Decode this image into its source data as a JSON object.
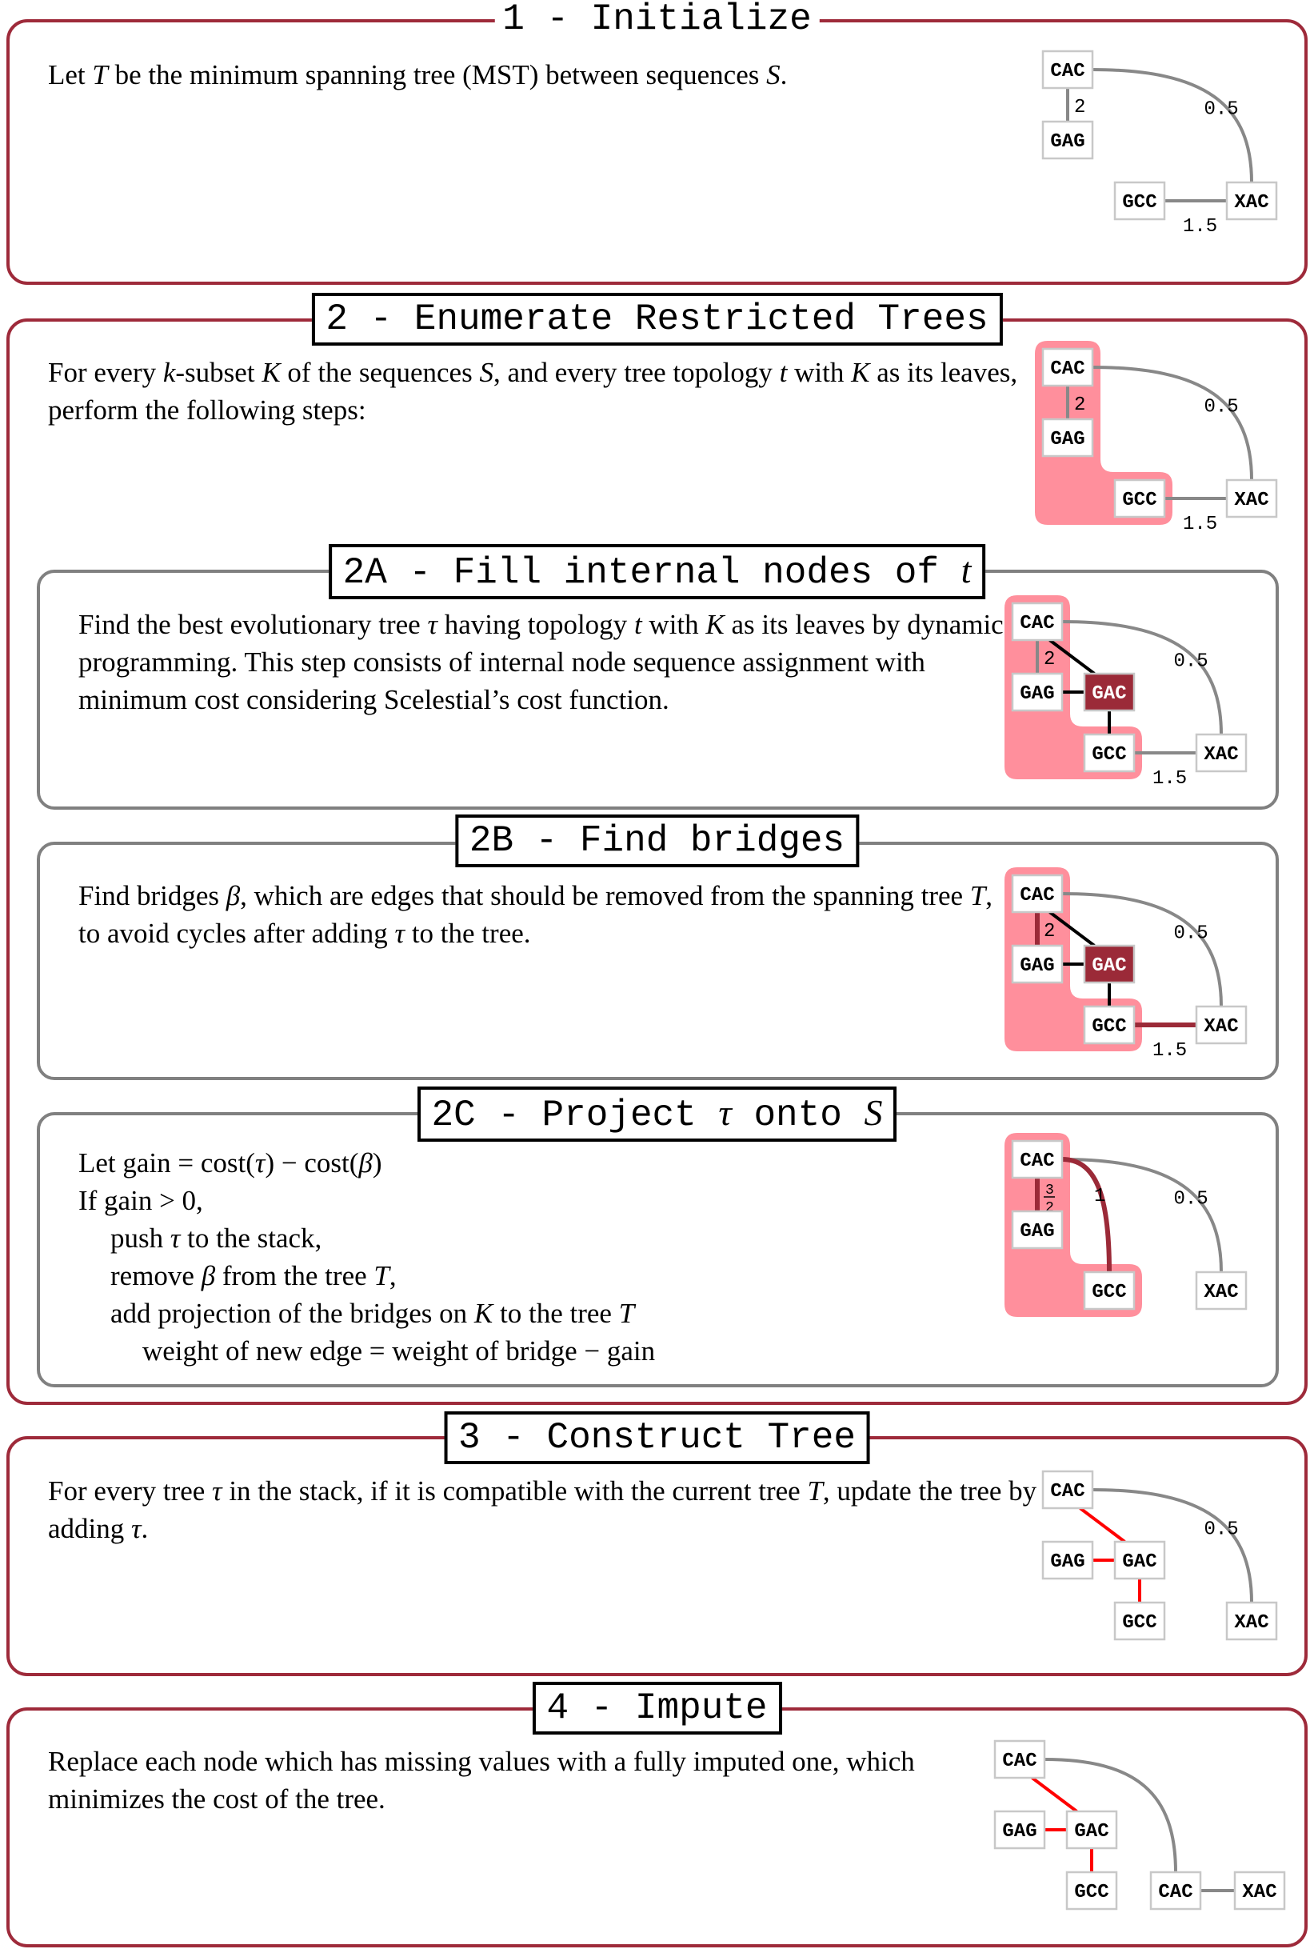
{
  "colors": {
    "outer_frame": "#9e2a3a",
    "inner_frame": "#808080",
    "highlight_fill": "#ff8f9c",
    "internal_node_fill": "#9b2a38",
    "node_border": "#c8c8c8",
    "mst_edge": "#888888",
    "tau_edge": "#000000",
    "bridge_edge": "#9b2a38",
    "added_edge": "#ff0000"
  },
  "sections": {
    "s1": {
      "title": "1 - Initialize",
      "text": [
        "Let ",
        {
          "math": "T"
        },
        " be the minimum spanning tree (MST) between sequences ",
        {
          "math": "S"
        },
        "."
      ]
    },
    "s2": {
      "title": "2 - Enumerate Restricted Trees",
      "text": [
        "For every ",
        {
          "math": "k"
        },
        "-subset ",
        {
          "math": "K"
        },
        " of the sequences ",
        {
          "math": "S"
        },
        ", and every tree topology ",
        {
          "math": "t"
        },
        " with ",
        {
          "math": "K"
        },
        " as its leaves, perform the following steps:"
      ]
    },
    "s2a": {
      "title_prefix": "2A - Fill internal nodes of ",
      "title_math": "t",
      "text": [
        "Find the best evolutionary tree ",
        {
          "math": "τ"
        },
        " having topology ",
        {
          "math": "t"
        },
        " with ",
        {
          "math": "K"
        },
        " as its leaves by dynamic programming.  This step consists of internal node sequence assignment with minimum cost considering Scelestial’s cost function."
      ]
    },
    "s2b": {
      "title": "2B - Find bridges",
      "text": [
        "Find bridges ",
        {
          "math": "β"
        },
        ", which are edges that should be removed from the spanning tree ",
        {
          "math": "T"
        },
        ", to avoid cycles after adding ",
        {
          "math": "τ"
        },
        " to the tree."
      ]
    },
    "s2c": {
      "title_prefix": "2C - Project ",
      "title_math1": "τ",
      "title_mid": " onto ",
      "title_math2": "S",
      "lines": [
        {
          "indent": 0,
          "parts": [
            "Let gain = cost(",
            {
              "math": "τ"
            },
            ") − cost(",
            {
              "math": "β"
            },
            ")"
          ]
        },
        {
          "indent": 0,
          "parts": [
            "If gain > 0,"
          ]
        },
        {
          "indent": 1,
          "parts": [
            "push ",
            {
              "math": "τ"
            },
            " to the stack,"
          ]
        },
        {
          "indent": 1,
          "parts": [
            "remove ",
            {
              "math": "β"
            },
            " from the tree ",
            {
              "math": "T"
            },
            ","
          ]
        },
        {
          "indent": 1,
          "parts": [
            "add projection of the bridges on ",
            {
              "math": "K"
            },
            " to the tree ",
            {
              "math": "T"
            }
          ]
        },
        {
          "indent": 2,
          "parts": [
            "weight of new edge = weight of bridge − gain"
          ]
        }
      ]
    },
    "s3": {
      "title": "3 - Construct Tree",
      "text": [
        "For every tree ",
        {
          "math": "τ"
        },
        " in the stack, if it is compatible with the current tree ",
        {
          "math": "T"
        },
        ", update the tree by adding ",
        {
          "math": "τ"
        },
        "."
      ]
    },
    "s4": {
      "title": "4 - Impute",
      "text": [
        "Replace each node which has missing values with a fully imputed one, which minimizes the cost of the tree."
      ]
    }
  },
  "diagrams": {
    "d1": {
      "nodes": [
        {
          "id": "CAC1",
          "label": "CAC",
          "col": 0,
          "row": 0
        },
        {
          "id": "GAG",
          "label": "GAG",
          "col": 0,
          "row": 1
        },
        {
          "id": "GCC",
          "label": "GCC",
          "col": 1,
          "row": 2
        },
        {
          "id": "XAC",
          "label": "XAC",
          "col": 2,
          "row": 2
        }
      ],
      "edges": [
        {
          "from": "CAC1",
          "to": "GAG",
          "label": "2",
          "style": "mst"
        },
        {
          "from": "CAC1",
          "to": "XAC",
          "label": "0.5",
          "style": "mst",
          "curve": true
        },
        {
          "from": "GCC",
          "to": "XAC",
          "label": "1.5",
          "style": "mst"
        }
      ]
    },
    "d2": {
      "highlight": [
        "CAC1",
        "GAG",
        "GCC"
      ],
      "nodes": [
        {
          "id": "CAC1",
          "label": "CAC",
          "col": 0,
          "row": 0
        },
        {
          "id": "GAG",
          "label": "GAG",
          "col": 0,
          "row": 1
        },
        {
          "id": "GCC",
          "label": "GCC",
          "col": 1,
          "row": 2
        },
        {
          "id": "XAC",
          "label": "XAC",
          "col": 2,
          "row": 2
        }
      ],
      "edges": [
        {
          "from": "CAC1",
          "to": "GAG",
          "label": "2",
          "style": "mst"
        },
        {
          "from": "CAC1",
          "to": "XAC",
          "label": "0.5",
          "style": "mst",
          "curve": true
        },
        {
          "from": "GCC",
          "to": "XAC",
          "label": "1.5",
          "style": "mst"
        }
      ]
    },
    "d2a": {
      "highlight": [
        "CAC1",
        "GAG",
        "GCC"
      ],
      "nodes": [
        {
          "id": "CAC1",
          "label": "CAC",
          "col": 0,
          "row": 0
        },
        {
          "id": "GAG",
          "label": "GAG",
          "col": 0,
          "row": 1
        },
        {
          "id": "GAC",
          "label": "GAC",
          "col": 1,
          "row": 1,
          "internal": true
        },
        {
          "id": "GCC",
          "label": "GCC",
          "col": 1,
          "row": 2
        },
        {
          "id": "XAC",
          "label": "XAC",
          "col": 2,
          "row": 2
        }
      ],
      "edges": [
        {
          "from": "CAC1",
          "to": "GAG",
          "label": "2",
          "style": "mst"
        },
        {
          "from": "CAC1",
          "to": "XAC",
          "label": "0.5",
          "style": "mst",
          "curve": true
        },
        {
          "from": "GCC",
          "to": "XAC",
          "label": "1.5",
          "style": "mst"
        },
        {
          "from": "CAC1",
          "to": "GAC",
          "style": "tau"
        },
        {
          "from": "GAG",
          "to": "GAC",
          "style": "tau"
        },
        {
          "from": "GAC",
          "to": "GCC",
          "style": "tau"
        }
      ]
    },
    "d2b": {
      "highlight": [
        "CAC1",
        "GAG",
        "GCC"
      ],
      "nodes": [
        {
          "id": "CAC1",
          "label": "CAC",
          "col": 0,
          "row": 0
        },
        {
          "id": "GAG",
          "label": "GAG",
          "col": 0,
          "row": 1
        },
        {
          "id": "GAC",
          "label": "GAC",
          "col": 1,
          "row": 1,
          "internal": true
        },
        {
          "id": "GCC",
          "label": "GCC",
          "col": 1,
          "row": 2
        },
        {
          "id": "XAC",
          "label": "XAC",
          "col": 2,
          "row": 2
        }
      ],
      "edges": [
        {
          "from": "CAC1",
          "to": "GAG",
          "label": "2",
          "style": "bridge"
        },
        {
          "from": "CAC1",
          "to": "XAC",
          "label": "0.5",
          "style": "mst",
          "curve": true
        },
        {
          "from": "GCC",
          "to": "XAC",
          "label": "1.5",
          "style": "bridge"
        },
        {
          "from": "CAC1",
          "to": "GAC",
          "style": "tau"
        },
        {
          "from": "GAG",
          "to": "GAC",
          "style": "tau"
        },
        {
          "from": "GAC",
          "to": "GCC",
          "style": "tau"
        }
      ]
    },
    "d2c": {
      "highlight": [
        "CAC1",
        "GAG",
        "GCC"
      ],
      "nodes": [
        {
          "id": "CAC1",
          "label": "CAC",
          "col": 0,
          "row": 0
        },
        {
          "id": "GAG",
          "label": "GAG",
          "col": 0,
          "row": 1
        },
        {
          "id": "GCC",
          "label": "GCC",
          "col": 1,
          "row": 2
        },
        {
          "id": "XAC",
          "label": "XAC",
          "col": 2,
          "row": 2
        }
      ],
      "edges": [
        {
          "from": "CAC1",
          "to": "GAG",
          "label": "3/2",
          "fraction": true,
          "style": "bridge"
        },
        {
          "from": "CAC1",
          "to": "XAC",
          "label": "0.5",
          "style": "mst",
          "curve": true
        },
        {
          "from": "CAC1",
          "to": "GCC",
          "label": "1",
          "style": "bridge",
          "curve": true
        }
      ]
    },
    "d3": {
      "nodes": [
        {
          "id": "CAC1",
          "label": "CAC",
          "col": 0,
          "row": 0
        },
        {
          "id": "GAG",
          "label": "GAG",
          "col": 0,
          "row": 1
        },
        {
          "id": "GAC",
          "label": "GAC",
          "col": 1,
          "row": 1
        },
        {
          "id": "GCC",
          "label": "GCC",
          "col": 1,
          "row": 2
        },
        {
          "id": "XAC",
          "label": "XAC",
          "col": 2,
          "row": 2
        }
      ],
      "edges": [
        {
          "from": "CAC1",
          "to": "XAC",
          "label": "0.5",
          "style": "mst",
          "curve": true
        },
        {
          "from": "CAC1",
          "to": "GAC",
          "style": "added"
        },
        {
          "from": "GAG",
          "to": "GAC",
          "style": "added"
        },
        {
          "from": "GAC",
          "to": "GCC",
          "style": "added"
        }
      ]
    },
    "d4": {
      "nodes": [
        {
          "id": "CAC1",
          "label": "CAC",
          "col": 0,
          "row": 0
        },
        {
          "id": "GAG",
          "label": "GAG",
          "col": 0,
          "row": 1
        },
        {
          "id": "GAC",
          "label": "GAC",
          "col": 1,
          "row": 1
        },
        {
          "id": "GCC",
          "label": "GCC",
          "col": 1,
          "row": 2
        },
        {
          "id": "CAC2",
          "label": "CAC",
          "col": 2,
          "row": 2
        },
        {
          "id": "XAC",
          "label": "XAC",
          "col": 3,
          "row": 2
        }
      ],
      "edges": [
        {
          "from": "CAC1",
          "to": "CAC2",
          "style": "mst",
          "curve": true
        },
        {
          "from": "CAC2",
          "to": "XAC",
          "style": "mst"
        },
        {
          "from": "CAC1",
          "to": "GAC",
          "style": "added"
        },
        {
          "from": "GAG",
          "to": "GAC",
          "style": "added"
        },
        {
          "from": "GAC",
          "to": "GCC",
          "style": "added"
        }
      ]
    }
  }
}
